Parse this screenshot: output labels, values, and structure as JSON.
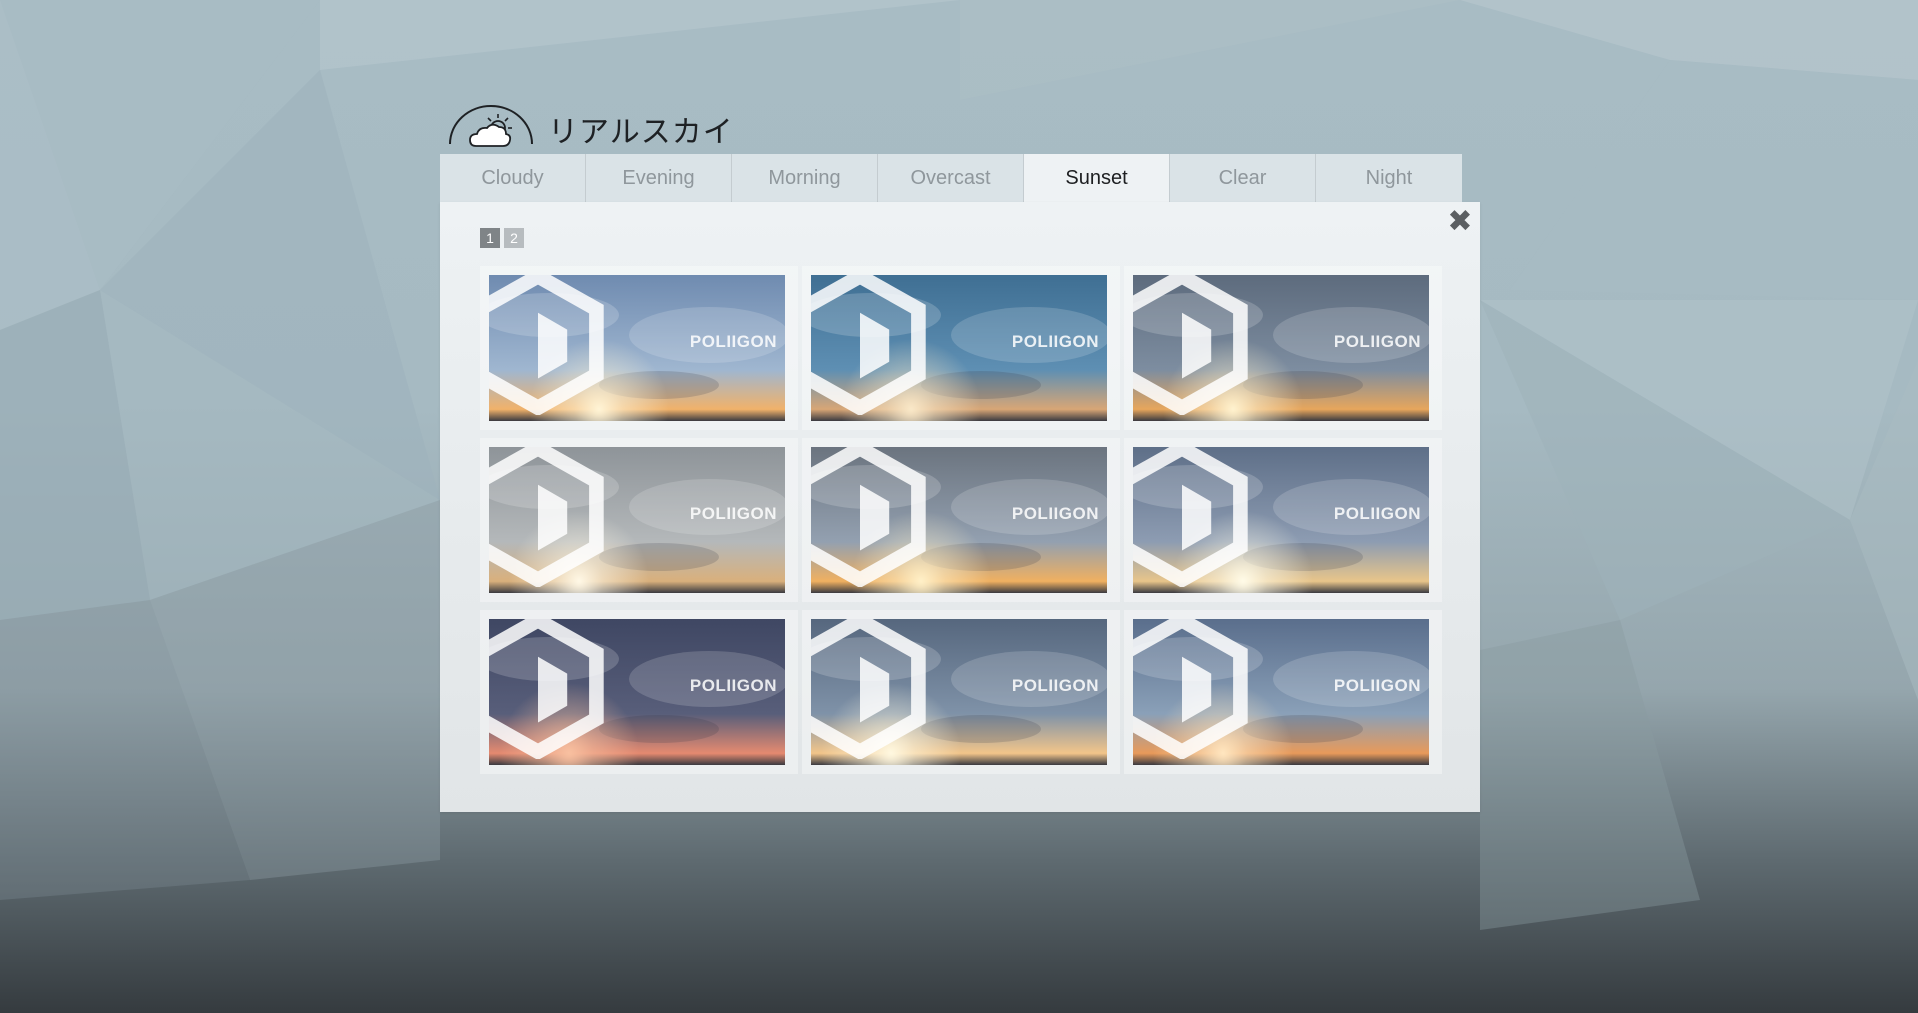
{
  "app": {
    "title": "リアルスカイ",
    "title_icon": "cloud-sun-icon"
  },
  "tabs": [
    {
      "label": "Cloudy",
      "active": false
    },
    {
      "label": "Evening",
      "active": false
    },
    {
      "label": "Morning",
      "active": false
    },
    {
      "label": "Overcast",
      "active": false
    },
    {
      "label": "Sunset",
      "active": true
    },
    {
      "label": "Clear",
      "active": false
    },
    {
      "label": "Night",
      "active": false
    }
  ],
  "panel": {
    "close_icon": "close-icon",
    "pages": [
      {
        "label": "1",
        "active": true
      },
      {
        "label": "2",
        "active": false
      }
    ],
    "watermark": "POLIIGON",
    "thumbnails": [
      {
        "top": "#6f8bb0",
        "mid": "#9fb6d0",
        "horizon": "#f1b26a",
        "sun": "#fff4d6"
      },
      {
        "top": "#3f6f93",
        "mid": "#5e8fb3",
        "horizon": "#d8a676",
        "sun": "#f9e8c8"
      },
      {
        "top": "#5d6b7d",
        "mid": "#7d8da0",
        "horizon": "#e7a65c",
        "sun": "#fff2cf"
      },
      {
        "top": "#8e9499",
        "mid": "#b4b8ba",
        "horizon": "#d9b07c",
        "sun": "#fff8e6"
      },
      {
        "top": "#6b747f",
        "mid": "#93a0b0",
        "horizon": "#f0b060",
        "sun": "#fff0c8"
      },
      {
        "top": "#5e6f88",
        "mid": "#8d9cb2",
        "horizon": "#e8c58a",
        "sun": "#fffbe8"
      },
      {
        "top": "#3f4763",
        "mid": "#585e7a",
        "horizon": "#e58a70",
        "sun": "#f8c0a0"
      },
      {
        "top": "#56677e",
        "mid": "#7f92a8",
        "horizon": "#f2c58a",
        "sun": "#fff8e0"
      },
      {
        "top": "#5a6e8c",
        "mid": "#8aa0b8",
        "horizon": "#e89a5a",
        "sun": "#ffe6c0"
      }
    ]
  }
}
